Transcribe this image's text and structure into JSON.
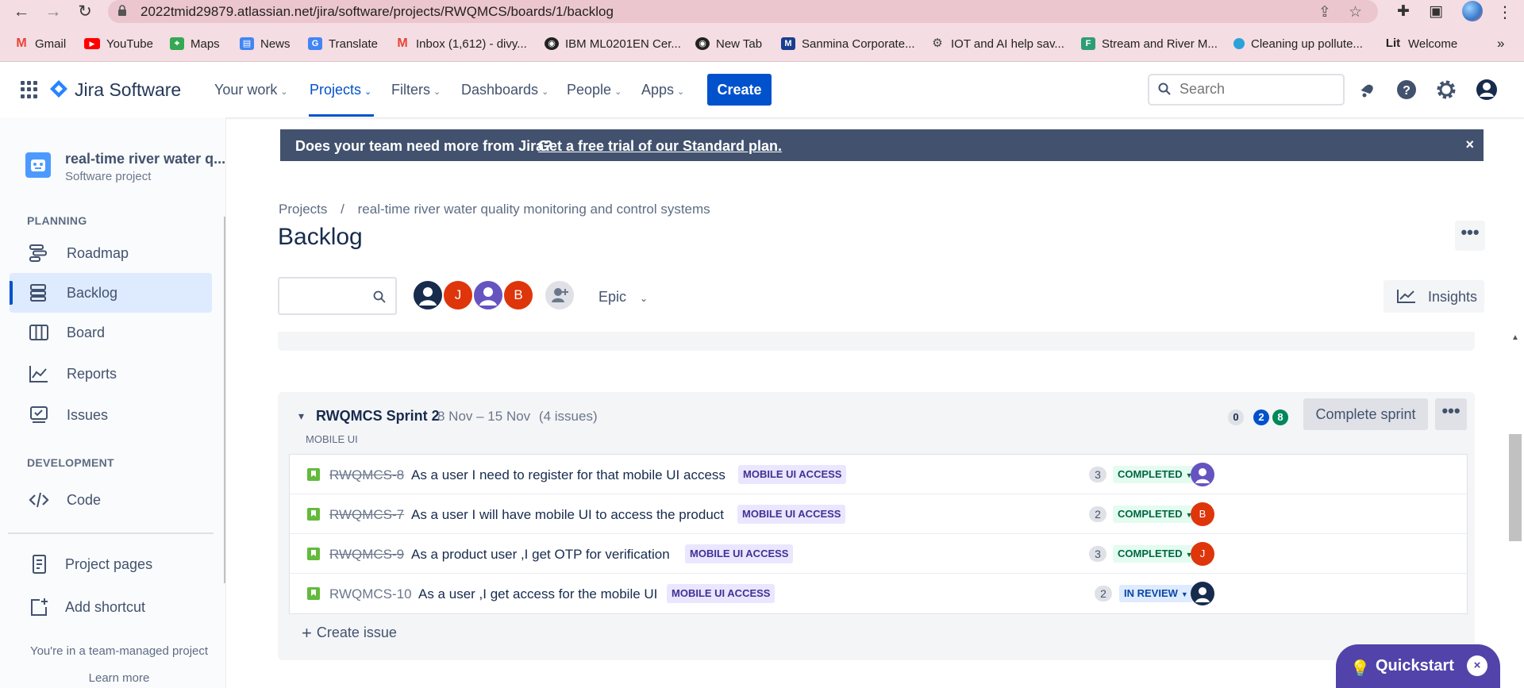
{
  "browser": {
    "url": "2022tmid29879.atlassian.net/jira/software/projects/RWQMCS/boards/1/backlog",
    "bookmarks": [
      {
        "label": "Gmail",
        "color": "#ea4335"
      },
      {
        "label": "YouTube",
        "color": "#ff0000"
      },
      {
        "label": "Maps",
        "color": "#34a853"
      },
      {
        "label": "News",
        "color": "#4285f4"
      },
      {
        "label": "Translate",
        "color": "#4285f4"
      },
      {
        "label": "Inbox (1,612) - divy...",
        "color": "#ea4335"
      },
      {
        "label": "IBM ML0201EN Cer...",
        "color": "#222222"
      },
      {
        "label": "New Tab",
        "color": "#222222"
      },
      {
        "label": "Sanmina Corporate...",
        "color": "#1a3d8f"
      },
      {
        "label": "IOT and AI help sav...",
        "color": "#444444"
      },
      {
        "label": "Stream and River M...",
        "color": "#2d9d78"
      },
      {
        "label": "Cleaning up pollute...",
        "color": "#29a3d9"
      },
      {
        "label": "Welcome",
        "color": "#222222"
      }
    ],
    "bookmark_fav_letters": {
      "sanmina": "M",
      "stream": "F",
      "lit": "Lit"
    },
    "bookmarks_more": "»"
  },
  "topnav": {
    "brand": "Jira Software",
    "items": [
      "Your work",
      "Projects",
      "Filters",
      "Dashboards",
      "People",
      "Apps"
    ],
    "active": "Projects",
    "create_label": "Create",
    "search_placeholder": "Search"
  },
  "sidebar": {
    "project_name": "real-time river water q...",
    "project_type": "Software project",
    "planning_heading": "PLANNING",
    "planning_items": [
      "Roadmap",
      "Backlog",
      "Board",
      "Reports",
      "Issues"
    ],
    "selected": "Backlog",
    "development_heading": "DEVELOPMENT",
    "development_items": [
      "Code"
    ],
    "extra_items": [
      "Project pages",
      "Add shortcut"
    ],
    "team_note": "You're in a team-managed project",
    "learn_more": "Learn more"
  },
  "banner": {
    "question": "Does your team need more from Jira?",
    "link": "Get a free trial of our Standard plan.",
    "close": "×"
  },
  "page": {
    "breadcrumb_root": "Projects",
    "breadcrumb_sep": "/",
    "breadcrumb_project": "real-time river water quality monitoring and control systems",
    "title": "Backlog",
    "more": "•••",
    "epic_filter": "Epic",
    "insights": "Insights"
  },
  "filter_avatars": [
    {
      "initial": "",
      "color": "#172b4d"
    },
    {
      "initial": "J",
      "color": "#de350b"
    },
    {
      "initial": "",
      "color": "#6554c0"
    },
    {
      "initial": "B",
      "color": "#de350b"
    }
  ],
  "sprint": {
    "name": "RWQMCS Sprint 2",
    "dates": "8 Nov – 15 Nov",
    "count": "(4 issues)",
    "goal": "MOBILE UI",
    "counts": [
      {
        "value": "0",
        "bg": "#dfe1e6",
        "fg": "#172b4d"
      },
      {
        "value": "2",
        "bg": "#0052cc",
        "fg": "#ffffff"
      },
      {
        "value": "8",
        "bg": "#00875a",
        "fg": "#ffffff"
      }
    ],
    "complete_label": "Complete sprint",
    "more": "•••",
    "create_issue": "Create issue",
    "issues": [
      {
        "key": "RWQMCS-8",
        "summary": "As a user I need to register for that mobile UI access",
        "epic": "MOBILE UI ACCESS",
        "points": "3",
        "status": "COMPLETED",
        "assignee": "",
        "assignee_color": "#6554c0"
      },
      {
        "key": "RWQMCS-7",
        "summary": "As a user I will have mobile UI to access the product",
        "epic": "MOBILE UI ACCESS",
        "points": "2",
        "status": "COMPLETED",
        "assignee": "B",
        "assignee_color": "#de350b"
      },
      {
        "key": "RWQMCS-9",
        "summary": "As a product user ,I get OTP for verification",
        "epic": "MOBILE UI ACCESS",
        "points": "3",
        "status": "COMPLETED",
        "assignee": "J",
        "assignee_color": "#de350b"
      },
      {
        "key": "RWQMCS-10",
        "summary": "As a user ,I get access for the mobile UI",
        "epic": "MOBILE UI ACCESS",
        "points": "2",
        "status": "IN REVIEW",
        "assignee": "",
        "assignee_color": "#172b4d"
      }
    ]
  },
  "quickstart": {
    "label": "Quickstart",
    "close": "×"
  }
}
